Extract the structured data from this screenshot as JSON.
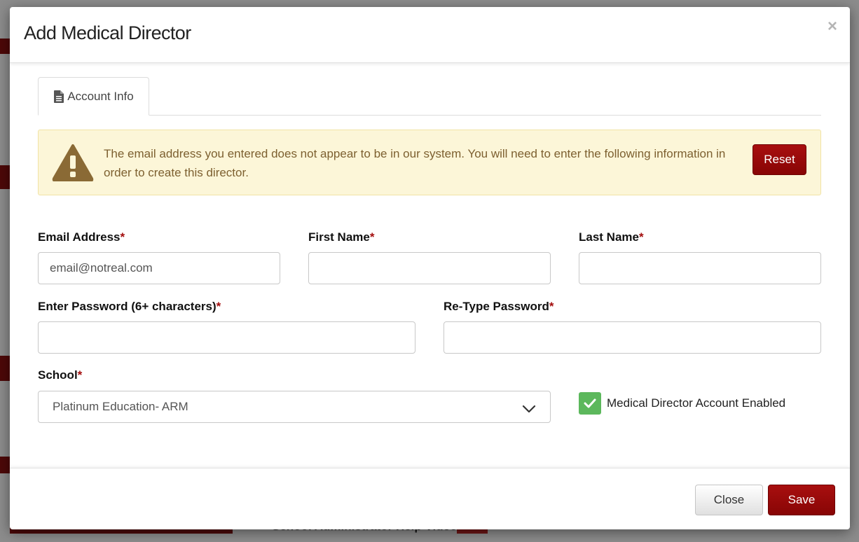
{
  "modal": {
    "title": "Add Medical Director",
    "close_symbol": "×"
  },
  "tabs": [
    {
      "label": "Account Info",
      "icon": "document-icon",
      "active": true
    }
  ],
  "alert": {
    "icon": "warning-icon",
    "message": "The email address you entered does not appear to be in our system. You will need to enter the following information in order to create this director.",
    "reset_label": "Reset"
  },
  "form": {
    "email": {
      "label": "Email Address",
      "required_mark": "*",
      "value": "email@notreal.com"
    },
    "first_name": {
      "label": "First Name",
      "required_mark": "*",
      "value": ""
    },
    "last_name": {
      "label": "Last Name",
      "required_mark": "*",
      "value": ""
    },
    "password": {
      "label": "Enter Password (6+ characters)",
      "required_mark": "*",
      "value": ""
    },
    "retype_password": {
      "label": "Re-Type Password",
      "required_mark": "*",
      "value": ""
    },
    "school": {
      "label": "School",
      "required_mark": "*",
      "selected": "Platinum Education- ARM"
    },
    "account_enabled": {
      "label": "Medical Director Account Enabled",
      "checked": true
    }
  },
  "footer": {
    "close_label": "Close",
    "save_label": "Save"
  },
  "background": {
    "help_videos_text": "School Administrator Help Videos",
    "new_badge": "New!"
  },
  "colors": {
    "primary_red": "#9a0a0a",
    "alert_bg": "#fcf6d8",
    "alert_text": "#7d6030",
    "checkbox_green": "#5cb85c"
  }
}
